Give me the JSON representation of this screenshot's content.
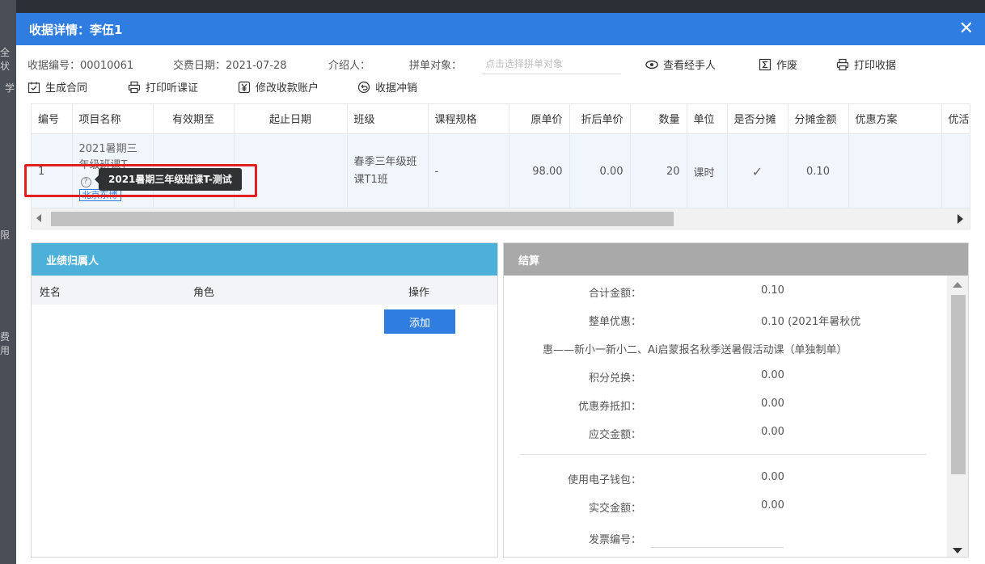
{
  "modal": {
    "title": "收据详情：李伍1",
    "close": "✕"
  },
  "info": {
    "receipt_no": "收据编号：00010061",
    "pay_date": "交费日期：2021-07-28",
    "referrer": "介绍人：",
    "group_target": "拼单对象：",
    "group_placeholder": "点击选择拼单对象"
  },
  "actions": {
    "view_handler": "查看经手人",
    "void": "作废",
    "print_receipt": "打印收据",
    "generate_contract": "生成合同",
    "print_trial": "打印听课证",
    "modify_account": "修改收款账户",
    "reverse": "收据冲销"
  },
  "table": {
    "headers": [
      "编号",
      "项目名称",
      "有效期至",
      "起止日期",
      "班级",
      "课程规格",
      "原单价",
      "折后单价",
      "数量",
      "单位",
      "是否分摊",
      "分摊金额",
      "优惠方案",
      "优活"
    ],
    "row": {
      "no": "1",
      "project_name": "2021暑期三年级班课T",
      "project_tag": "北京东博",
      "valid_until": "",
      "date_range": "",
      "class": "春季三年级班课T1班",
      "spec": "-",
      "orig_price": "98.00",
      "disc_price": "0.00",
      "qty": "20",
      "unit": "课时",
      "shared": "✓",
      "share_amount": "0.10",
      "promo": ""
    }
  },
  "tooltip": "2021暑期三年级班课T-测试",
  "performance": {
    "title": "业绩归属人",
    "col_name": "姓名",
    "col_role": "角色",
    "col_action": "操作",
    "add_label": "添加"
  },
  "settlement": {
    "title": "结算",
    "total_label": "合计金额：",
    "total_value": "0.10",
    "whole_discount_label": "整单优惠：",
    "whole_discount_value": "0.10 (2021年暑秋优",
    "whole_discount_cont": "惠——新小一新小二、Ai启蒙报名秋季送暑假活动课（单独制单）",
    "points_label": "积分兑换：",
    "points_value": "0.00",
    "coupon_label": "优惠券抵扣：",
    "coupon_value": "0.00",
    "payable_label": "应交金额：",
    "payable_value": "0.00",
    "wallet_label": "使用电子钱包：",
    "wallet_value": "0.00",
    "actual_label": "实交金额：",
    "actual_value": "0.00",
    "invoice_label": "发票编号："
  },
  "background": {
    "frag1": "全状",
    "frag2": "学",
    "frag3": "限",
    "frag4": "费用"
  },
  "colors": {
    "primary": "#2f7de1",
    "perf_header": "#4cb0d8",
    "settle_header": "#a9a9a9",
    "highlight": "#e02020"
  }
}
